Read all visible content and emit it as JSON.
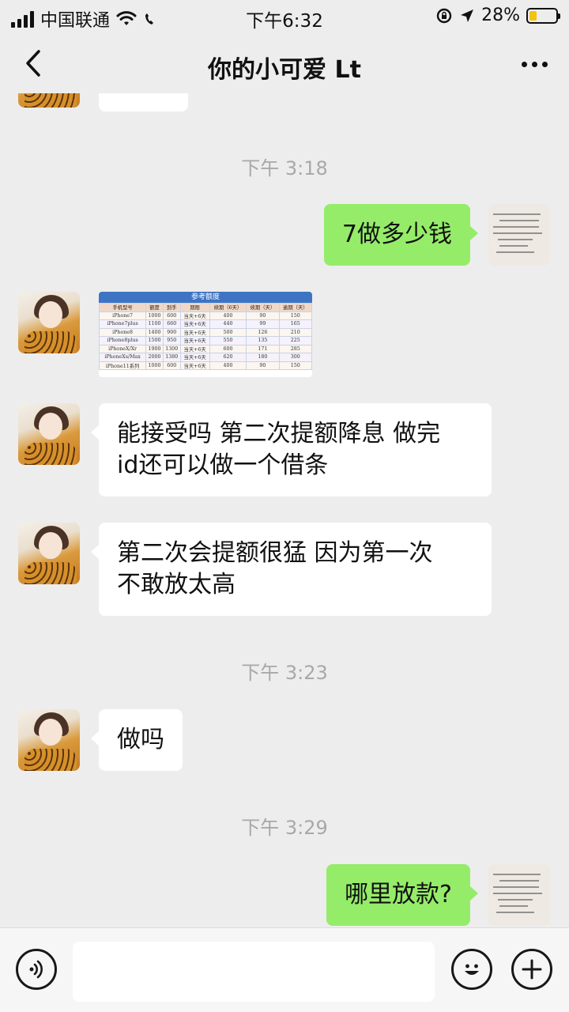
{
  "status_bar": {
    "carrier": "中国联通",
    "time": "下午6:32",
    "battery": "28%",
    "battery_level": 0.28
  },
  "nav": {
    "title": "你的小可爱 Lt"
  },
  "chat": {
    "timestamps": [
      "下午 3:18",
      "下午 3:23",
      "下午 3:29"
    ],
    "messages": {
      "m1": "7做多少钱",
      "m2": {
        "title": "参考额度",
        "headers": [
          "手机型号",
          "额度",
          "到手",
          "期限",
          "续期（6天）",
          "续期（天）",
          "逾期（天）"
        ],
        "rows": [
          [
            "iPhone7",
            "1000",
            "600",
            "当天+6天",
            "400",
            "90",
            "150"
          ],
          [
            "iPhone7plus",
            "1100",
            "660",
            "当天+6天",
            "440",
            "99",
            "165"
          ],
          [
            "iPhone8",
            "1400",
            "900",
            "当天+6天",
            "500",
            "126",
            "210"
          ],
          [
            "iPhone8plus",
            "1500",
            "950",
            "当天+6天",
            "550",
            "135",
            "225"
          ],
          [
            "iPhoneX/Xr",
            "1900",
            "1300",
            "当天+6天",
            "600",
            "171",
            "285"
          ],
          [
            "iPhoneXs/Max",
            "2000",
            "1380",
            "当天+6天",
            "620",
            "180",
            "300"
          ],
          [
            "iPhone11系列",
            "1000",
            "600",
            "当天+6天",
            "400",
            "90",
            "150"
          ]
        ]
      },
      "m3_line1": "能接受吗 第二次提额降息 做完",
      "m3_line2": "id还可以做一个借条",
      "m4_line1": "第二次会提额很猛 因为第一次",
      "m4_line2": "不敢放太高",
      "m5": "做吗",
      "m6": "哪里放款?"
    }
  },
  "input": {
    "value": ""
  }
}
